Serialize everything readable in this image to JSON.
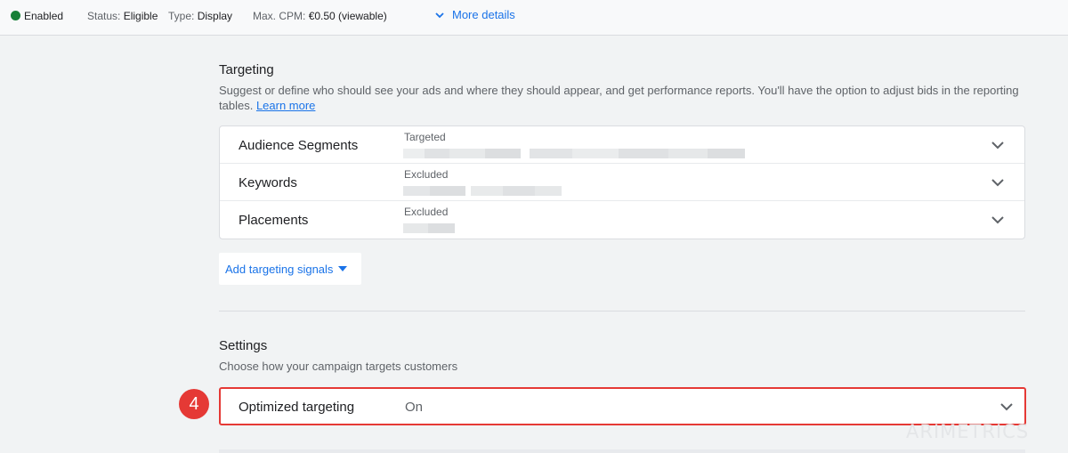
{
  "header": {
    "enabled_label": "Enabled",
    "status_label": "Status:",
    "status_value": "Eligible",
    "type_label": "Type:",
    "type_value": "Display",
    "cpm_label": "Max. CPM:",
    "cpm_value": "€0.50 (viewable)",
    "more_details": "More details",
    "status_color": "#188038"
  },
  "targeting": {
    "title": "Targeting",
    "description_line1": "Suggest or define who should see your ads and where they should appear, and get performance reports. You'll have the option to adjust bids in the reporting",
    "description_line2": "tables.",
    "learn_more": "Learn more",
    "rows": [
      {
        "label": "Audience Segments",
        "sub": "Targeted"
      },
      {
        "label": "Keywords",
        "sub": "Excluded"
      },
      {
        "label": "Placements",
        "sub": "Excluded"
      }
    ],
    "add_signals": "Add targeting signals"
  },
  "settings": {
    "title": "Settings",
    "description": "Choose how your campaign targets customers",
    "optimized_label": "Optimized targeting",
    "optimized_value": "On"
  },
  "annotation": {
    "number": "4",
    "color": "#e53935"
  },
  "watermark": "ARIMETRICS"
}
